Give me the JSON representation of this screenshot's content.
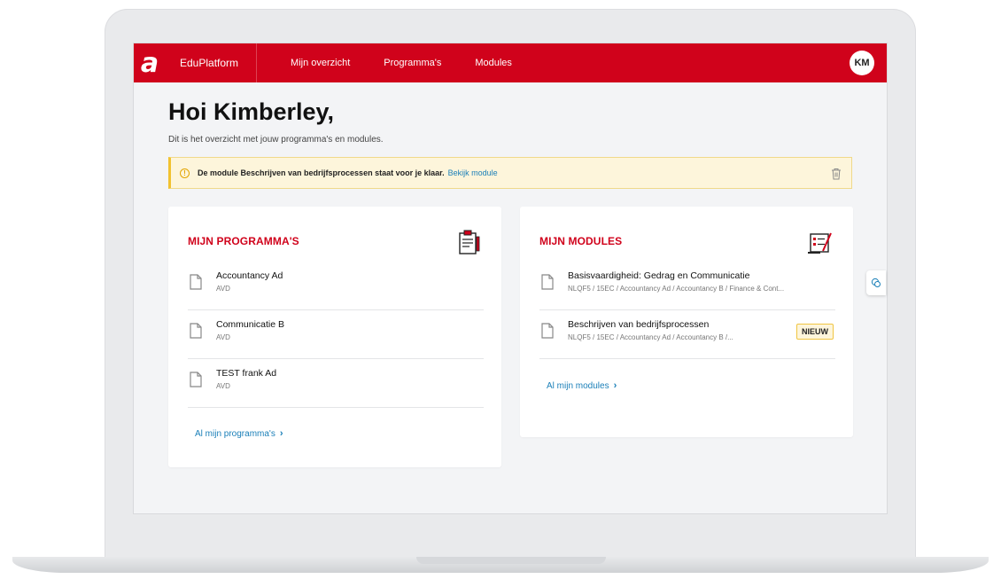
{
  "colors": {
    "brand_red": "#d0021b",
    "link_blue": "#1a7fb8",
    "alert_bg": "#fdf5db",
    "alert_accent": "#f2c230"
  },
  "nav": {
    "logo": "a",
    "brand": "EduPlatform",
    "items": [
      "Mijn overzicht",
      "Programma's",
      "Modules"
    ],
    "avatar_initials": "KM"
  },
  "greeting": "Hoi Kimberley,",
  "subtitle": "Dit is het overzicht met jouw programma's en modules.",
  "alert": {
    "icon": "info-icon",
    "text": "De module Beschrijven van bedrijfsprocessen staat voor je klaar.",
    "link": "Bekijk module",
    "dismiss_icon": "trash-icon"
  },
  "programs": {
    "title": "MIJN PROGRAMMA'S",
    "items": [
      {
        "title": "Accountancy Ad",
        "sub": "AVD"
      },
      {
        "title": "Communicatie B",
        "sub": "AVD"
      },
      {
        "title": "TEST frank Ad",
        "sub": "AVD"
      }
    ],
    "more_link": "Al mijn programma's"
  },
  "modules": {
    "title": "MIJN MODULES",
    "items": [
      {
        "title": "Basisvaardigheid: Gedrag en Communicatie",
        "sub": "NLQF5 / 15EC / Accountancy Ad / Accountancy B / Finance & Cont..."
      },
      {
        "title": "Beschrijven van bedrijfsprocessen",
        "sub": "NLQF5 / 15EC / Accountancy Ad / Accountancy B /...",
        "badge": "NIEUW"
      }
    ],
    "more_link": "Al mijn modules"
  }
}
